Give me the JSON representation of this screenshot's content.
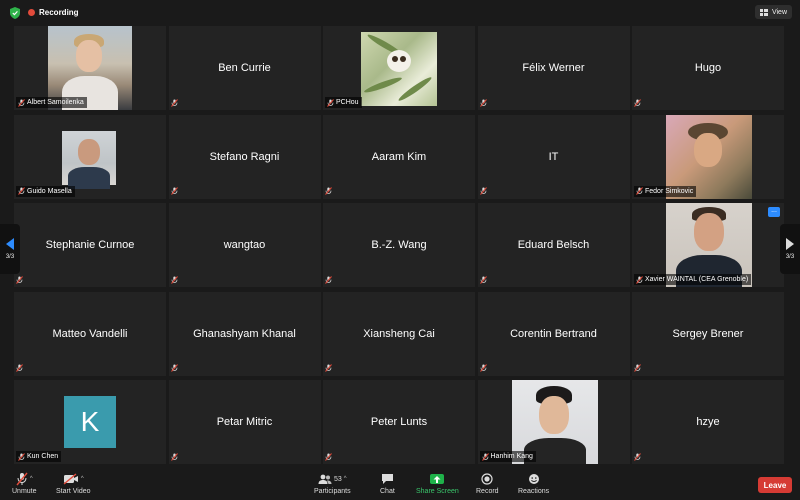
{
  "topbar": {
    "recording_label": "Recording",
    "view_label": "View",
    "colors": {
      "recording": "#e24b3b",
      "shield": "#2fb34a"
    }
  },
  "participants": [
    {
      "name": "Albert Samoilenka",
      "show_name": false,
      "photo": "albert"
    },
    {
      "name": "Ben Currie",
      "show_name": true
    },
    {
      "name": "PCHou",
      "show_name": false,
      "photo": "pchou"
    },
    {
      "name": "Félix Werner",
      "show_name": true
    },
    {
      "name": "Hugo",
      "show_name": true
    },
    {
      "name": "Guido Masella",
      "show_name": false,
      "photo": "guido"
    },
    {
      "name": "Stefano Ragni",
      "show_name": true
    },
    {
      "name": "Aaram Kim",
      "show_name": true
    },
    {
      "name": "IT",
      "show_name": true
    },
    {
      "name": "Fedor Simkovic",
      "show_name": false,
      "photo": "fedor"
    },
    {
      "name": "Stephanie Curnoe",
      "show_name": true
    },
    {
      "name": "wangtao",
      "show_name": true
    },
    {
      "name": "B.-Z. Wang",
      "show_name": true
    },
    {
      "name": "Eduard Belsch",
      "show_name": true
    },
    {
      "name": "Xavier WAINTAL (CEA Grenoble)",
      "show_name": false,
      "photo": "xavier"
    },
    {
      "name": "Matteo Vandelli",
      "show_name": true
    },
    {
      "name": "Ghanashyam Khanal",
      "show_name": true
    },
    {
      "name": "Xiansheng Cai",
      "show_name": true
    },
    {
      "name": "Corentin Bertrand",
      "show_name": true
    },
    {
      "name": "Sergey Brener",
      "show_name": true
    },
    {
      "name": "Kun Chen",
      "show_name": false,
      "photo": "kun",
      "avatar_letter": "K"
    },
    {
      "name": "Petar Mitric",
      "show_name": true
    },
    {
      "name": "Peter Lunts",
      "show_name": true
    },
    {
      "name": "Hanhim Kang",
      "show_name": false,
      "photo": "hanhim"
    },
    {
      "name": "hzye",
      "show_name": true
    }
  ],
  "pager": {
    "left": "3/3",
    "right": "3/3"
  },
  "toolbar": {
    "unmute": "Unmute",
    "start_video": "Start Video",
    "participants": "Participants",
    "participants_count": "53",
    "chat": "Chat",
    "share_screen": "Share Screen",
    "record": "Record",
    "reactions": "Reactions",
    "leave": "Leave"
  },
  "more_button": "...",
  "colors": {
    "accent": "#2d8cff",
    "leave": "#d63b34",
    "share": "#1fb24a"
  }
}
